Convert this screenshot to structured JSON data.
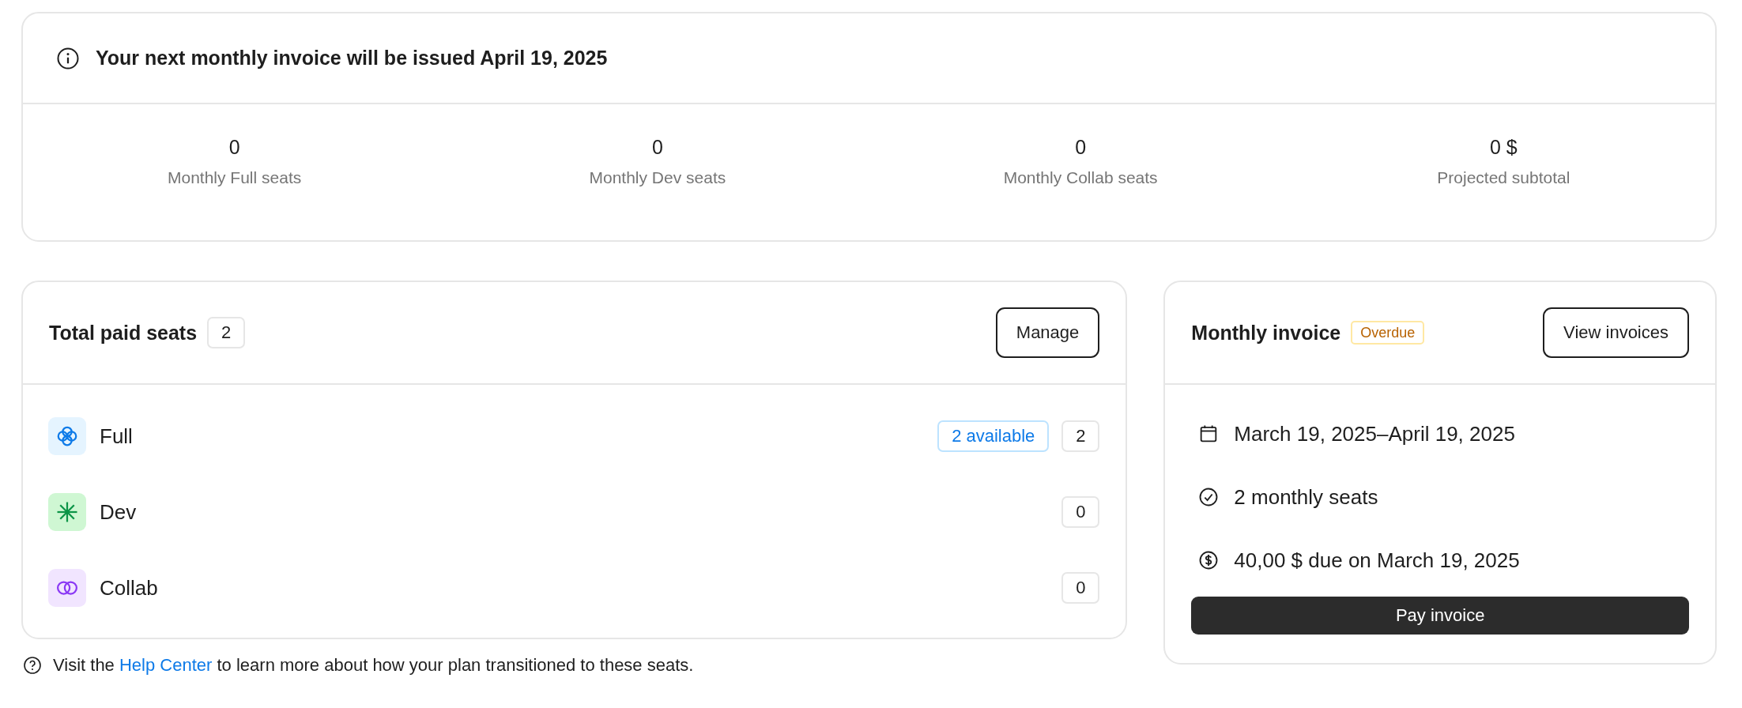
{
  "next_invoice": {
    "message": "Your next monthly invoice will be issued April 19, 2025"
  },
  "stats": [
    {
      "value": "0",
      "label": "Monthly Full seats"
    },
    {
      "value": "0",
      "label": "Monthly Dev seats"
    },
    {
      "value": "0",
      "label": "Monthly Collab seats"
    },
    {
      "value": "0 $",
      "label": "Projected subtotal"
    }
  ],
  "seats": {
    "title": "Total paid seats",
    "count": "2",
    "manage_button": "Manage",
    "items": [
      {
        "kind": "full",
        "name": "Full",
        "available": "2 available",
        "count": "2"
      },
      {
        "kind": "dev",
        "name": "Dev",
        "count": "0"
      },
      {
        "kind": "collab",
        "name": "Collab",
        "count": "0"
      }
    ]
  },
  "help": {
    "before": "Visit the",
    "link": "Help Center",
    "after": "to learn more about how your plan transitioned to these seats."
  },
  "invoice": {
    "title": "Monthly invoice",
    "status": "Overdue",
    "view_button": "View invoices",
    "details": [
      {
        "kind": "calendar",
        "text": "March 19, 2025–April 19, 2025"
      },
      {
        "kind": "check",
        "text": "2 monthly seats"
      },
      {
        "kind": "dollar",
        "text": "40,00 $ due on March 19, 2025"
      }
    ],
    "pay_button": "Pay invoice"
  }
}
